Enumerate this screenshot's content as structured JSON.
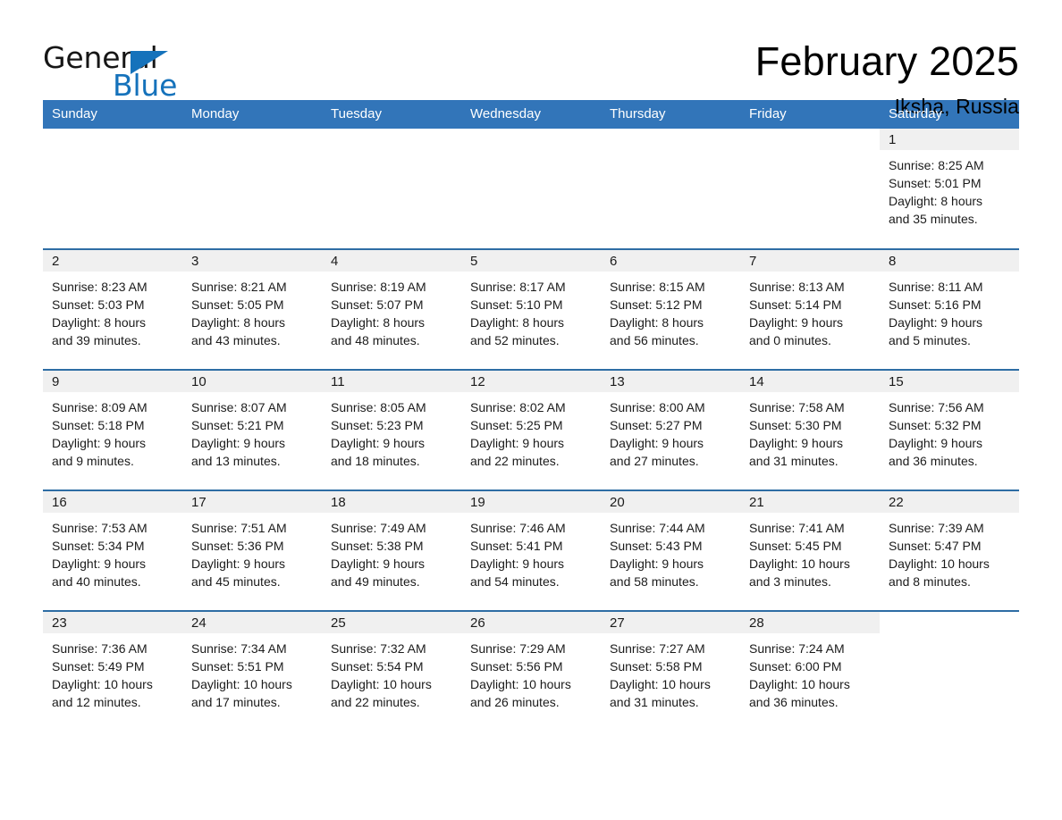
{
  "brand": {
    "name_part1": "General",
    "name_part2": "Blue",
    "accent_color": "#1572bb"
  },
  "header": {
    "month_title": "February 2025",
    "location": "Iksha, Russia"
  },
  "theme": {
    "header_blue": "#3275b9",
    "row_divider_blue": "#2e6da4",
    "daynum_bg": "#f0f0f0"
  },
  "weekday_headers": [
    "Sunday",
    "Monday",
    "Tuesday",
    "Wednesday",
    "Thursday",
    "Friday",
    "Saturday"
  ],
  "labels": {
    "sunrise_prefix": "Sunrise:",
    "sunset_prefix": "Sunset:",
    "daylight_prefix": "Daylight:"
  },
  "weeks": [
    [
      {
        "day": "",
        "blank": true
      },
      {
        "day": "",
        "blank": true
      },
      {
        "day": "",
        "blank": true
      },
      {
        "day": "",
        "blank": true
      },
      {
        "day": "",
        "blank": true
      },
      {
        "day": "",
        "blank": true
      },
      {
        "day": "1",
        "sunrise": "Sunrise: 8:25 AM",
        "sunset": "Sunset: 5:01 PM",
        "daylight_line1": "Daylight: 8 hours",
        "daylight_line2": "and 35 minutes."
      }
    ],
    [
      {
        "day": "2",
        "sunrise": "Sunrise: 8:23 AM",
        "sunset": "Sunset: 5:03 PM",
        "daylight_line1": "Daylight: 8 hours",
        "daylight_line2": "and 39 minutes."
      },
      {
        "day": "3",
        "sunrise": "Sunrise: 8:21 AM",
        "sunset": "Sunset: 5:05 PM",
        "daylight_line1": "Daylight: 8 hours",
        "daylight_line2": "and 43 minutes."
      },
      {
        "day": "4",
        "sunrise": "Sunrise: 8:19 AM",
        "sunset": "Sunset: 5:07 PM",
        "daylight_line1": "Daylight: 8 hours",
        "daylight_line2": "and 48 minutes."
      },
      {
        "day": "5",
        "sunrise": "Sunrise: 8:17 AM",
        "sunset": "Sunset: 5:10 PM",
        "daylight_line1": "Daylight: 8 hours",
        "daylight_line2": "and 52 minutes."
      },
      {
        "day": "6",
        "sunrise": "Sunrise: 8:15 AM",
        "sunset": "Sunset: 5:12 PM",
        "daylight_line1": "Daylight: 8 hours",
        "daylight_line2": "and 56 minutes."
      },
      {
        "day": "7",
        "sunrise": "Sunrise: 8:13 AM",
        "sunset": "Sunset: 5:14 PM",
        "daylight_line1": "Daylight: 9 hours",
        "daylight_line2": "and 0 minutes."
      },
      {
        "day": "8",
        "sunrise": "Sunrise: 8:11 AM",
        "sunset": "Sunset: 5:16 PM",
        "daylight_line1": "Daylight: 9 hours",
        "daylight_line2": "and 5 minutes."
      }
    ],
    [
      {
        "day": "9",
        "sunrise": "Sunrise: 8:09 AM",
        "sunset": "Sunset: 5:18 PM",
        "daylight_line1": "Daylight: 9 hours",
        "daylight_line2": "and 9 minutes."
      },
      {
        "day": "10",
        "sunrise": "Sunrise: 8:07 AM",
        "sunset": "Sunset: 5:21 PM",
        "daylight_line1": "Daylight: 9 hours",
        "daylight_line2": "and 13 minutes."
      },
      {
        "day": "11",
        "sunrise": "Sunrise: 8:05 AM",
        "sunset": "Sunset: 5:23 PM",
        "daylight_line1": "Daylight: 9 hours",
        "daylight_line2": "and 18 minutes."
      },
      {
        "day": "12",
        "sunrise": "Sunrise: 8:02 AM",
        "sunset": "Sunset: 5:25 PM",
        "daylight_line1": "Daylight: 9 hours",
        "daylight_line2": "and 22 minutes."
      },
      {
        "day": "13",
        "sunrise": "Sunrise: 8:00 AM",
        "sunset": "Sunset: 5:27 PM",
        "daylight_line1": "Daylight: 9 hours",
        "daylight_line2": "and 27 minutes."
      },
      {
        "day": "14",
        "sunrise": "Sunrise: 7:58 AM",
        "sunset": "Sunset: 5:30 PM",
        "daylight_line1": "Daylight: 9 hours",
        "daylight_line2": "and 31 minutes."
      },
      {
        "day": "15",
        "sunrise": "Sunrise: 7:56 AM",
        "sunset": "Sunset: 5:32 PM",
        "daylight_line1": "Daylight: 9 hours",
        "daylight_line2": "and 36 minutes."
      }
    ],
    [
      {
        "day": "16",
        "sunrise": "Sunrise: 7:53 AM",
        "sunset": "Sunset: 5:34 PM",
        "daylight_line1": "Daylight: 9 hours",
        "daylight_line2": "and 40 minutes."
      },
      {
        "day": "17",
        "sunrise": "Sunrise: 7:51 AM",
        "sunset": "Sunset: 5:36 PM",
        "daylight_line1": "Daylight: 9 hours",
        "daylight_line2": "and 45 minutes."
      },
      {
        "day": "18",
        "sunrise": "Sunrise: 7:49 AM",
        "sunset": "Sunset: 5:38 PM",
        "daylight_line1": "Daylight: 9 hours",
        "daylight_line2": "and 49 minutes."
      },
      {
        "day": "19",
        "sunrise": "Sunrise: 7:46 AM",
        "sunset": "Sunset: 5:41 PM",
        "daylight_line1": "Daylight: 9 hours",
        "daylight_line2": "and 54 minutes."
      },
      {
        "day": "20",
        "sunrise": "Sunrise: 7:44 AM",
        "sunset": "Sunset: 5:43 PM",
        "daylight_line1": "Daylight: 9 hours",
        "daylight_line2": "and 58 minutes."
      },
      {
        "day": "21",
        "sunrise": "Sunrise: 7:41 AM",
        "sunset": "Sunset: 5:45 PM",
        "daylight_line1": "Daylight: 10 hours",
        "daylight_line2": "and 3 minutes."
      },
      {
        "day": "22",
        "sunrise": "Sunrise: 7:39 AM",
        "sunset": "Sunset: 5:47 PM",
        "daylight_line1": "Daylight: 10 hours",
        "daylight_line2": "and 8 minutes."
      }
    ],
    [
      {
        "day": "23",
        "sunrise": "Sunrise: 7:36 AM",
        "sunset": "Sunset: 5:49 PM",
        "daylight_line1": "Daylight: 10 hours",
        "daylight_line2": "and 12 minutes."
      },
      {
        "day": "24",
        "sunrise": "Sunrise: 7:34 AM",
        "sunset": "Sunset: 5:51 PM",
        "daylight_line1": "Daylight: 10 hours",
        "daylight_line2": "and 17 minutes."
      },
      {
        "day": "25",
        "sunrise": "Sunrise: 7:32 AM",
        "sunset": "Sunset: 5:54 PM",
        "daylight_line1": "Daylight: 10 hours",
        "daylight_line2": "and 22 minutes."
      },
      {
        "day": "26",
        "sunrise": "Sunrise: 7:29 AM",
        "sunset": "Sunset: 5:56 PM",
        "daylight_line1": "Daylight: 10 hours",
        "daylight_line2": "and 26 minutes."
      },
      {
        "day": "27",
        "sunrise": "Sunrise: 7:27 AM",
        "sunset": "Sunset: 5:58 PM",
        "daylight_line1": "Daylight: 10 hours",
        "daylight_line2": "and 31 minutes."
      },
      {
        "day": "28",
        "sunrise": "Sunrise: 7:24 AM",
        "sunset": "Sunset: 6:00 PM",
        "daylight_line1": "Daylight: 10 hours",
        "daylight_line2": "and 36 minutes."
      },
      {
        "day": "",
        "blank": true
      }
    ]
  ]
}
